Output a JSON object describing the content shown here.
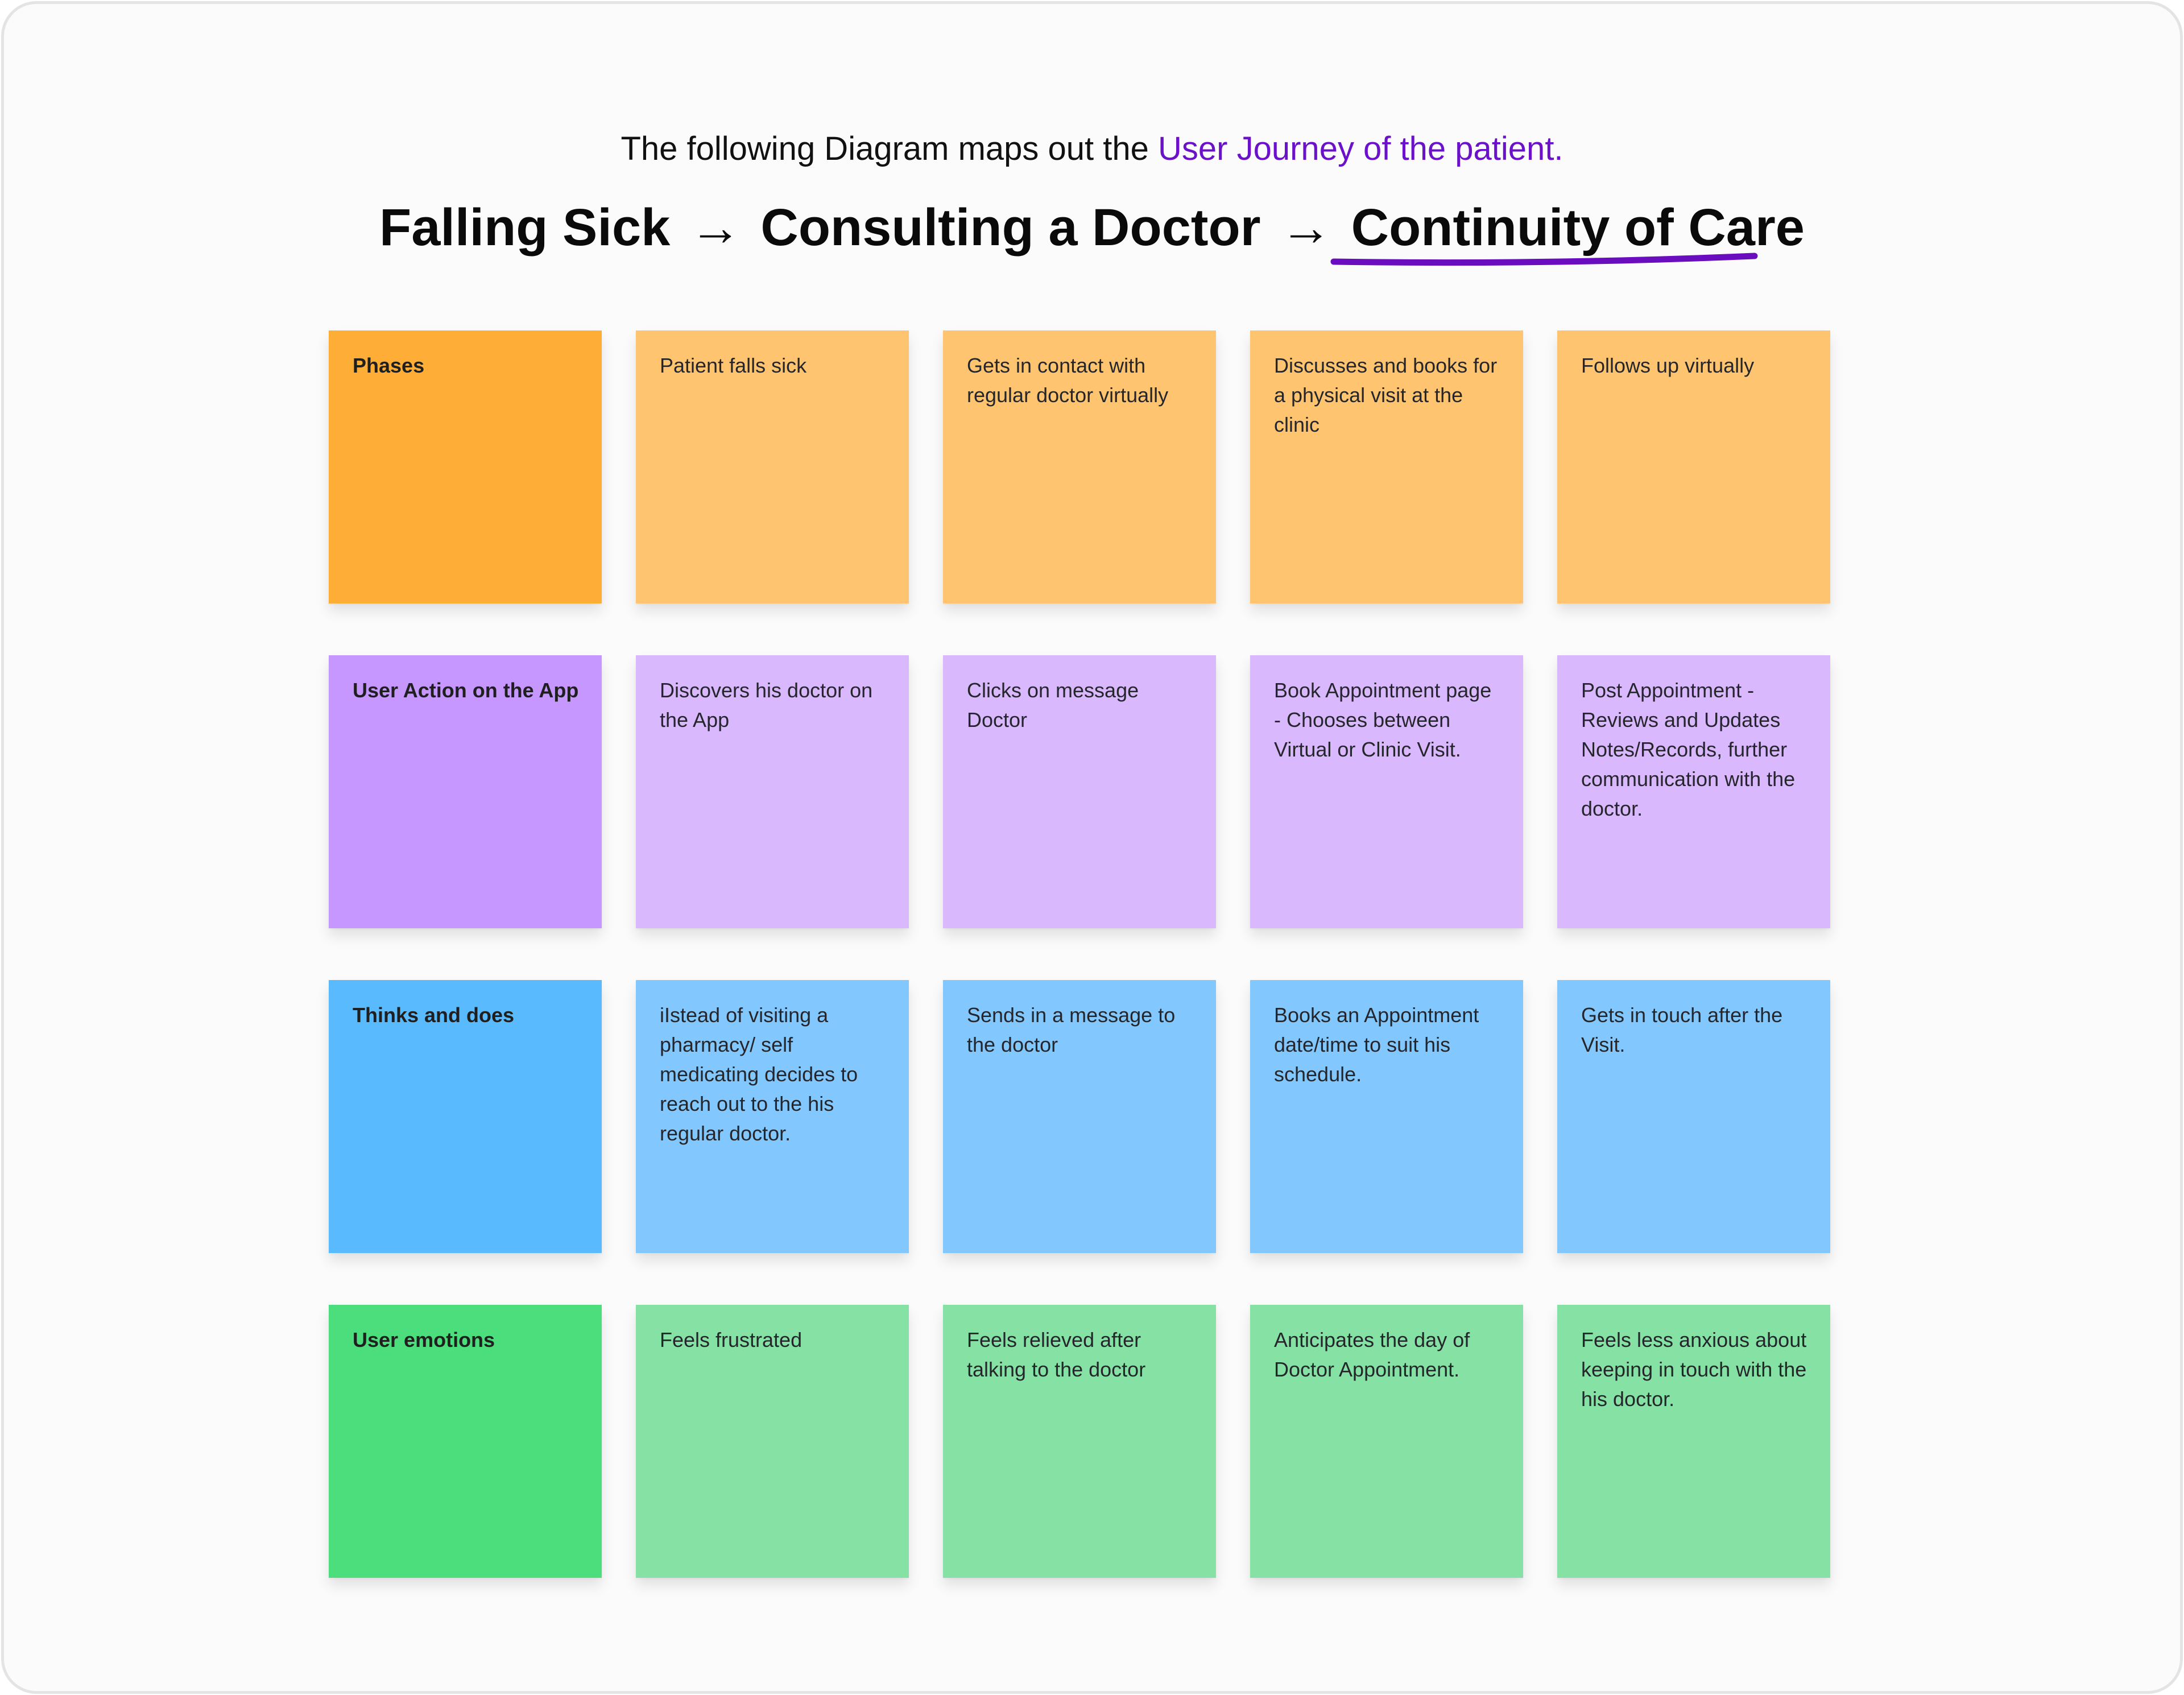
{
  "subtitle": {
    "prefix": "The following Diagram maps out the ",
    "accent": "User Journey of the patient."
  },
  "title": {
    "step1": "Falling Sick",
    "arrow1": "→",
    "step2": "Consulting a Doctor",
    "arrow2": "→",
    "step3": "Continuity of Care"
  },
  "colors": {
    "accent": "#6a11c9",
    "phases_header": "#feae36",
    "phases_cell": "#fec470",
    "actions_header": "#c697fe",
    "actions_cell": "#d9b8fe",
    "thinks_header": "#5abafe",
    "thinks_cell": "#82c8fe",
    "emotions_header": "#4cdd7c",
    "emotions_cell": "#86e1a4"
  },
  "rows": [
    {
      "key": "phases",
      "header": "Phases",
      "cells": [
        "Patient falls sick",
        "Gets in contact with regular doctor virtually",
        "Discusses and books for a physical visit at the clinic",
        "Follows up virtually"
      ]
    },
    {
      "key": "actions",
      "header": "User Action on the App",
      "cells": [
        "Discovers his doctor on the App",
        "Clicks on message Doctor",
        "Book Appointment page - Chooses between Virtual or Clinic Visit.",
        "Post Appointment - Reviews and Updates Notes/Records, further communication with the doctor."
      ]
    },
    {
      "key": "thinks",
      "header": "Thinks and does",
      "cells": [
        "iIstead of visiting a pharmacy/ self medicating decides to reach out to the his regular doctor.",
        "Sends in a message to the doctor",
        "Books an Appointment date/time to suit his schedule.",
        "Gets in touch after the Visit."
      ]
    },
    {
      "key": "emotions",
      "header": "User emotions",
      "cells": [
        "Feels frustrated",
        "Feels relieved after talking to the doctor",
        "Anticipates the day of Doctor Appointment.",
        "Feels less anxious about keeping in touch with the his doctor."
      ]
    }
  ]
}
